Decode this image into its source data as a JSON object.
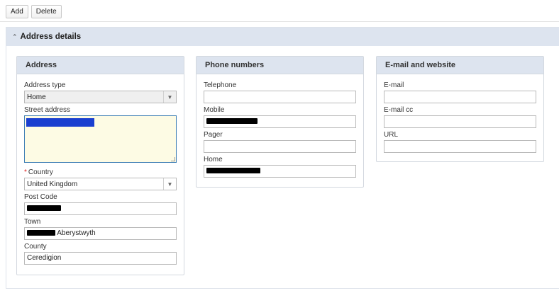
{
  "toolbar": {
    "add_label": "Add",
    "delete_label": "Delete"
  },
  "section": {
    "title": "Address details",
    "collapse_icon": "double-chevron-up-icon"
  },
  "address_panel": {
    "title": "Address",
    "address_type": {
      "label": "Address type",
      "value": "Home"
    },
    "street_address": {
      "label": "Street address",
      "value": ""
    },
    "country": {
      "required_mark": "*",
      "label": "Country",
      "value": "United Kingdom"
    },
    "post_code": {
      "label": "Post Code",
      "value": ""
    },
    "town": {
      "label": "Town",
      "value": "Aberystwyth"
    },
    "county": {
      "label": "County",
      "value": "Ceredigion"
    }
  },
  "phone_panel": {
    "title": "Phone numbers",
    "telephone": {
      "label": "Telephone",
      "value": ""
    },
    "mobile": {
      "label": "Mobile",
      "value": ""
    },
    "pager": {
      "label": "Pager",
      "value": ""
    },
    "home": {
      "label": "Home",
      "value": ""
    }
  },
  "email_panel": {
    "title": "E-mail and website",
    "email": {
      "label": "E-mail",
      "value": ""
    },
    "email_cc": {
      "label": "E-mail cc",
      "value": ""
    },
    "url": {
      "label": "URL",
      "value": ""
    }
  },
  "colors": {
    "header_bg": "#dde4ef",
    "required": "#dd2222",
    "textarea_bg": "#fdfbe4",
    "focus_border": "#3f7fb5"
  }
}
